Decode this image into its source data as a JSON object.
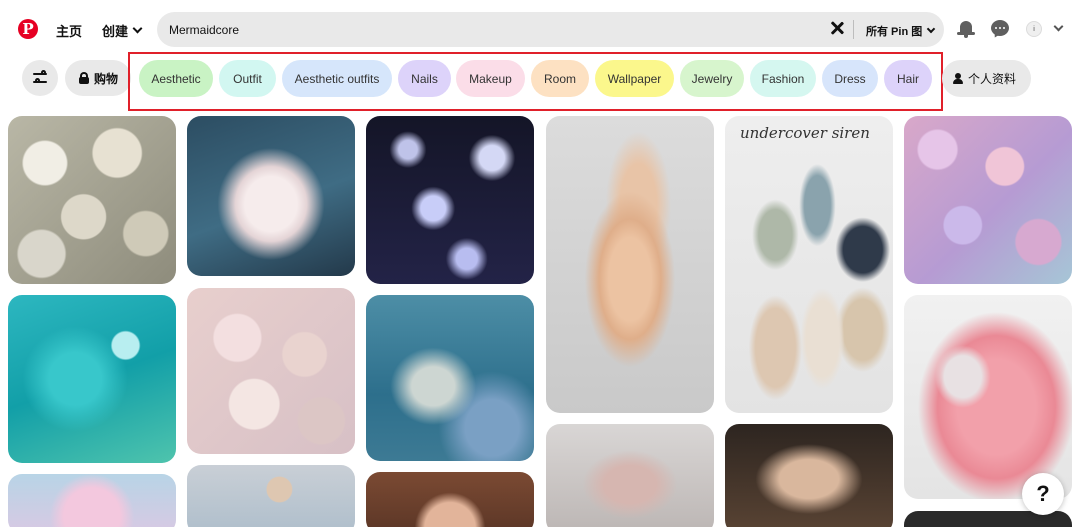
{
  "header": {
    "logo_letter": "P",
    "nav_home": "主页",
    "nav_create": "创建",
    "search_value": "Mermaidcore",
    "search_scope": "所有 Pin 图",
    "avatar_initial": "i"
  },
  "filters": {
    "shop_label": "购物",
    "chips": [
      {
        "label": "Aesthetic",
        "color": "#c9f3c4"
      },
      {
        "label": "Outfit",
        "color": "#d2f7f1"
      },
      {
        "label": "Aesthetic outfits",
        "color": "#d6e6fb"
      },
      {
        "label": "Nails",
        "color": "#ddd3fa"
      },
      {
        "label": "Makeup",
        "color": "#fbdde8"
      },
      {
        "label": "Room",
        "color": "#fde1c2"
      },
      {
        "label": "Wallpaper",
        "color": "#fbf78c"
      },
      {
        "label": "Jewelry",
        "color": "#d7f5cd"
      },
      {
        "label": "Fashion",
        "color": "#d5f7f0"
      },
      {
        "label": "Dress",
        "color": "#d7e5fb"
      },
      {
        "label": "Hair",
        "color": "#ddd3fa"
      }
    ],
    "profile_label": "个人资料"
  },
  "pins": {
    "overlay_caption": "undercover siren",
    "help_label": "?"
  },
  "colors": {
    "brand": "#e60023",
    "highlight_box": "#e0202a",
    "control_bg": "#e9e9e9"
  }
}
